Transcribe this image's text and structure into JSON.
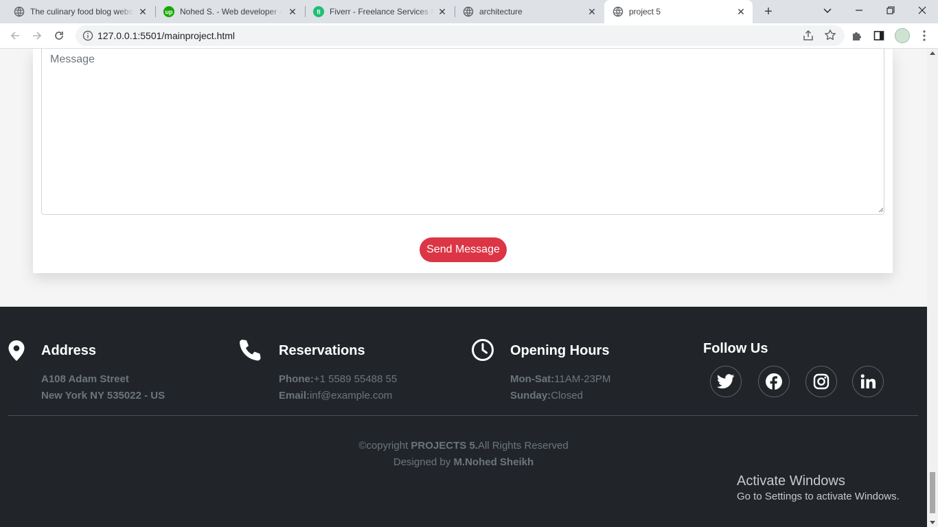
{
  "browser": {
    "tabs": [
      {
        "title": "The culinary food blog website",
        "favicon": "globe-icon"
      },
      {
        "title": "Nohed S. - Web developer - Upwork",
        "favicon": "upwork-icon"
      },
      {
        "title": "Fiverr - Freelance Services Marketplace",
        "favicon": "fiverr-icon"
      },
      {
        "title": "architecture",
        "favicon": "globe-icon"
      },
      {
        "title": "project 5",
        "favicon": "globe-icon",
        "active": true
      }
    ],
    "url": "127.0.0.1:5501/mainproject.html"
  },
  "contact": {
    "message_placeholder": "Message",
    "send_label": "Send Message"
  },
  "footer": {
    "address": {
      "heading": "Address",
      "line1": "A108 Adam Street",
      "line2": "New York NY 535022 - US"
    },
    "reservations": {
      "heading": "Reservations",
      "phone_label": "Phone:",
      "phone": "+1 5589 55488 55",
      "email_label": "Email:",
      "email": "inf@example.com"
    },
    "hours": {
      "heading": "Opening Hours",
      "weekdays_label": "Mon-Sat:",
      "weekdays": "11AM-23PM",
      "sunday_label": "Sunday:",
      "sunday": "Closed"
    },
    "follow": {
      "heading": "Follow Us",
      "networks": [
        "twitter-icon",
        "facebook-icon",
        "instagram-icon",
        "linkedin-icon"
      ]
    },
    "copyright_prefix": "©copyright",
    "copyright_brand": "PROJECTS 5.",
    "copyright_suffix": "All Rights Reserved",
    "designed_prefix": "Designed by",
    "designer": "M.Nohed Sheikh"
  },
  "watermark": {
    "title": "Activate Windows",
    "subtitle": "Go to Settings to activate Windows."
  },
  "colors": {
    "accent": "#dc3545",
    "footer_bg": "#212529",
    "muted": "#6c757d"
  }
}
